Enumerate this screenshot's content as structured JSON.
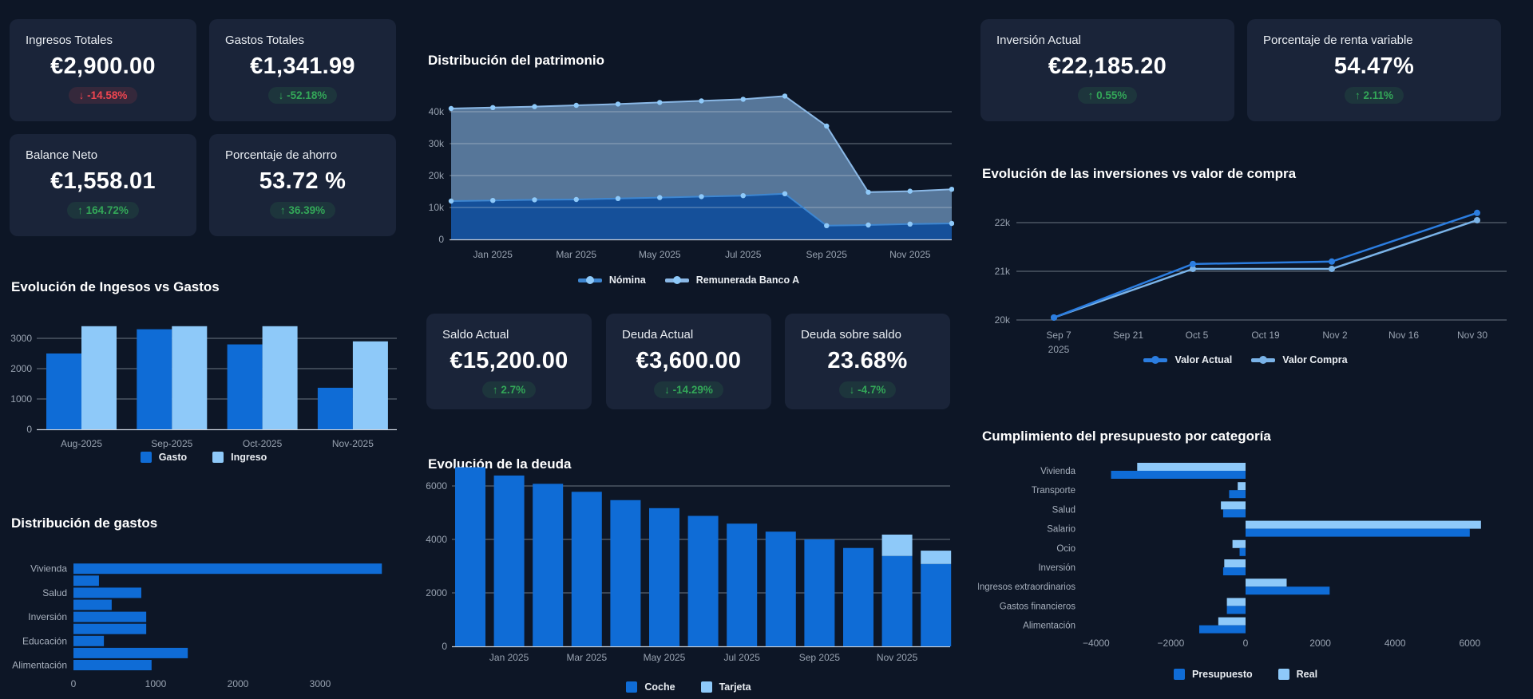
{
  "theme": {
    "page_bg": "#0d1626",
    "card_bg": "#1a2439",
    "primary_blue": "#0f6cd6",
    "light_blue": "#8ec9f9",
    "positive_green": "#33a758",
    "negative_red": "#ef4550"
  },
  "cards": {
    "left": [
      {
        "label": "Ingresos Totales",
        "value": "€2,900.00",
        "delta": "↓ -14.58%",
        "tone": "red"
      },
      {
        "label": "Gastos Totales",
        "value": "€1,341.99",
        "delta": "↓ -52.18%",
        "tone": "green"
      },
      {
        "label": "Balance Neto",
        "value": "€1,558.01",
        "delta": "↑ 164.72%",
        "tone": "green"
      },
      {
        "label": "Porcentaje de ahorro",
        "value": "53.72 %",
        "delta": "↑ 36.39%",
        "tone": "green"
      }
    ],
    "middle": [
      {
        "label": "Saldo Actual",
        "value": "€15,200.00",
        "delta": "↑ 2.7%",
        "tone": "green"
      },
      {
        "label": "Deuda Actual",
        "value": "€3,600.00",
        "delta": "↓ -14.29%",
        "tone": "green"
      },
      {
        "label": "Deuda sobre saldo",
        "value": "23.68%",
        "delta": "↓ -4.7%",
        "tone": "green"
      }
    ],
    "right": [
      {
        "label": "Inversión Actual",
        "value": "€22,185.20",
        "delta": "↑ 0.55%",
        "tone": "green"
      },
      {
        "label": "Porcentaje de renta variable",
        "value": "54.47%",
        "delta": "↑ 2.11%",
        "tone": "green"
      }
    ]
  },
  "chart_data": [
    {
      "type": "bar",
      "title": "Evolución de Ingesos vs Gastos",
      "categories": [
        "Aug-2025",
        "Sep-2025",
        "Oct-2025",
        "Nov-2025"
      ],
      "series": [
        {
          "name": "Gasto",
          "color": "#0f6cd6",
          "values": [
            2500,
            3300,
            2800,
            1370
          ]
        },
        {
          "name": "Ingreso",
          "color": "#8ec9f9",
          "values": [
            3400,
            3400,
            3400,
            2900
          ]
        }
      ],
      "yticks": [
        0,
        1000,
        2000,
        3000
      ],
      "ylim": [
        0,
        3450
      ],
      "grid": true,
      "legend_position": "bottom"
    },
    {
      "type": "bar",
      "orientation": "horizontal",
      "title": "Distribución de gastos",
      "color": "#0f6cd6",
      "bars": [
        {
          "label": "Vivienda",
          "value": 3750
        },
        {
          "label": "",
          "value": 310
        },
        {
          "label": "Salud",
          "value": 825
        },
        {
          "label": "",
          "value": 465
        },
        {
          "label": "Inversión",
          "value": 885
        },
        {
          "label": "",
          "value": 885
        },
        {
          "label": "Educación",
          "value": 370
        },
        {
          "label": "",
          "value": 1390
        },
        {
          "label": "Alimentación",
          "value": 950
        }
      ],
      "xticks": [
        0,
        1000,
        2000,
        3000
      ],
      "xlim": [
        0,
        3850
      ]
    },
    {
      "type": "area",
      "stacked": true,
      "title": "Distribución del patrimonio",
      "x_labels": [
        "Jan 2025",
        "Mar 2025",
        "May 2025",
        "Jul 2025",
        "Sep 2025",
        "Nov 2025"
      ],
      "label_indices": [
        1,
        3,
        5,
        7,
        9,
        11
      ],
      "series": [
        {
          "name": "Nómina",
          "line": "#3e86d0",
          "fill": "#15509a",
          "dot": "#8ec9f9",
          "values": [
            12000,
            12200,
            12400,
            12500,
            12800,
            13100,
            13400,
            13700,
            14300,
            4300,
            4500,
            4800,
            5000
          ]
        },
        {
          "name": "Remunerada Banco A",
          "line": "#8ab8e6",
          "fill": "#5c7fa3",
          "dot": "#8ec9f9",
          "values": [
            29000,
            29100,
            29200,
            29500,
            29600,
            29800,
            30000,
            30200,
            30600,
            31200,
            10300,
            10300,
            10700
          ]
        }
      ],
      "yticks": [
        0,
        10000,
        20000,
        30000,
        40000
      ],
      "ytick_labels": [
        "0",
        "10k",
        "20k",
        "30k",
        "40k"
      ],
      "ylim": [
        0,
        50000
      ],
      "legend_position": "bottom"
    },
    {
      "type": "bar",
      "stacked": true,
      "title": "Evolución de la deuda",
      "x_labels": [
        "Jan 2025",
        "Mar 2025",
        "May 2025",
        "Jul 2025",
        "Sep 2025",
        "Nov 2025"
      ],
      "label_indices": [
        1,
        3,
        5,
        7,
        9,
        11
      ],
      "series": [
        {
          "name": "Coche",
          "color": "#0f6cd6",
          "values": [
            6700,
            6390,
            6080,
            5780,
            5470,
            5170,
            4880,
            4590,
            4290,
            4000,
            3680,
            3380,
            3080
          ]
        },
        {
          "name": "Tarjeta",
          "color": "#8ec9f9",
          "values": [
            0,
            0,
            0,
            0,
            0,
            0,
            0,
            0,
            0,
            0,
            0,
            800,
            500
          ]
        }
      ],
      "yticks": [
        0,
        2000,
        4000,
        6000
      ],
      "ylim": [
        0,
        6800
      ],
      "legend_position": "bottom"
    },
    {
      "type": "line",
      "title": "Evolución de las inversiones vs valor de compra",
      "xticks": [
        "Sep 7",
        "Sep 21",
        "Oct 5",
        "Oct 19",
        "Nov 2",
        "Nov 16",
        "Nov 30"
      ],
      "xtick_year": "2025",
      "series": [
        {
          "name": "Valor Actual",
          "color": "#2b7de0",
          "values": [
            20050,
            21150,
            21200,
            22200
          ]
        },
        {
          "name": "Valor Compra",
          "color": "#7ab3e8",
          "values": [
            20050,
            21050,
            21050,
            22050
          ]
        }
      ],
      "yticks": [
        20000,
        21000,
        22000
      ],
      "ytick_labels": [
        "20k",
        "21k",
        "22k"
      ],
      "ylim": [
        19800,
        22400
      ],
      "legend_position": "bottom"
    },
    {
      "type": "bar",
      "orientation": "horizontal",
      "grouped": true,
      "title": "Cumplimiento del presupuesto por categoría",
      "categories": [
        "Vivienda",
        "Transporte",
        "Salud",
        "Salario",
        "Ocio",
        "Inversión",
        "Ingresos extraordinarios",
        "Gastos financieros",
        "Alimentación"
      ],
      "series": [
        {
          "name": "Presupuesto",
          "color": "#0f6cd6",
          "values": [
            -3600,
            -440,
            -600,
            6000,
            -160,
            -600,
            2250,
            -500,
            -1240
          ]
        },
        {
          "name": "Real",
          "color": "#8ec9f9",
          "values": [
            -2900,
            -210,
            -660,
            6300,
            -350,
            -570,
            1100,
            -500,
            -730
          ]
        }
      ],
      "xticks": [
        -4000,
        -2000,
        0,
        2000,
        4000,
        6000
      ],
      "xtick_labels": [
        "−4000",
        "−2000",
        "0",
        "2000",
        "4000",
        "6000"
      ],
      "xlim": [
        -4500,
        7200
      ],
      "legend_position": "bottom"
    }
  ]
}
